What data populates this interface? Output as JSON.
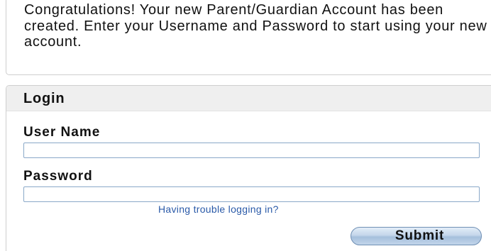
{
  "notice": {
    "message": "Congratulations! Your new Parent/Guardian Account has been created. Enter your Username and Password to start using your new account."
  },
  "login": {
    "title": "Login",
    "username_label": "User Name",
    "username_value": "",
    "password_label": "Password",
    "password_value": "",
    "trouble_link": "Having trouble logging in?",
    "submit_label": "Submit"
  },
  "colors": {
    "link": "#2a5aa8",
    "input_border": "#8aa8c8",
    "header_bg": "#efefef",
    "button_gradient_mid": "#a6bfdc"
  }
}
